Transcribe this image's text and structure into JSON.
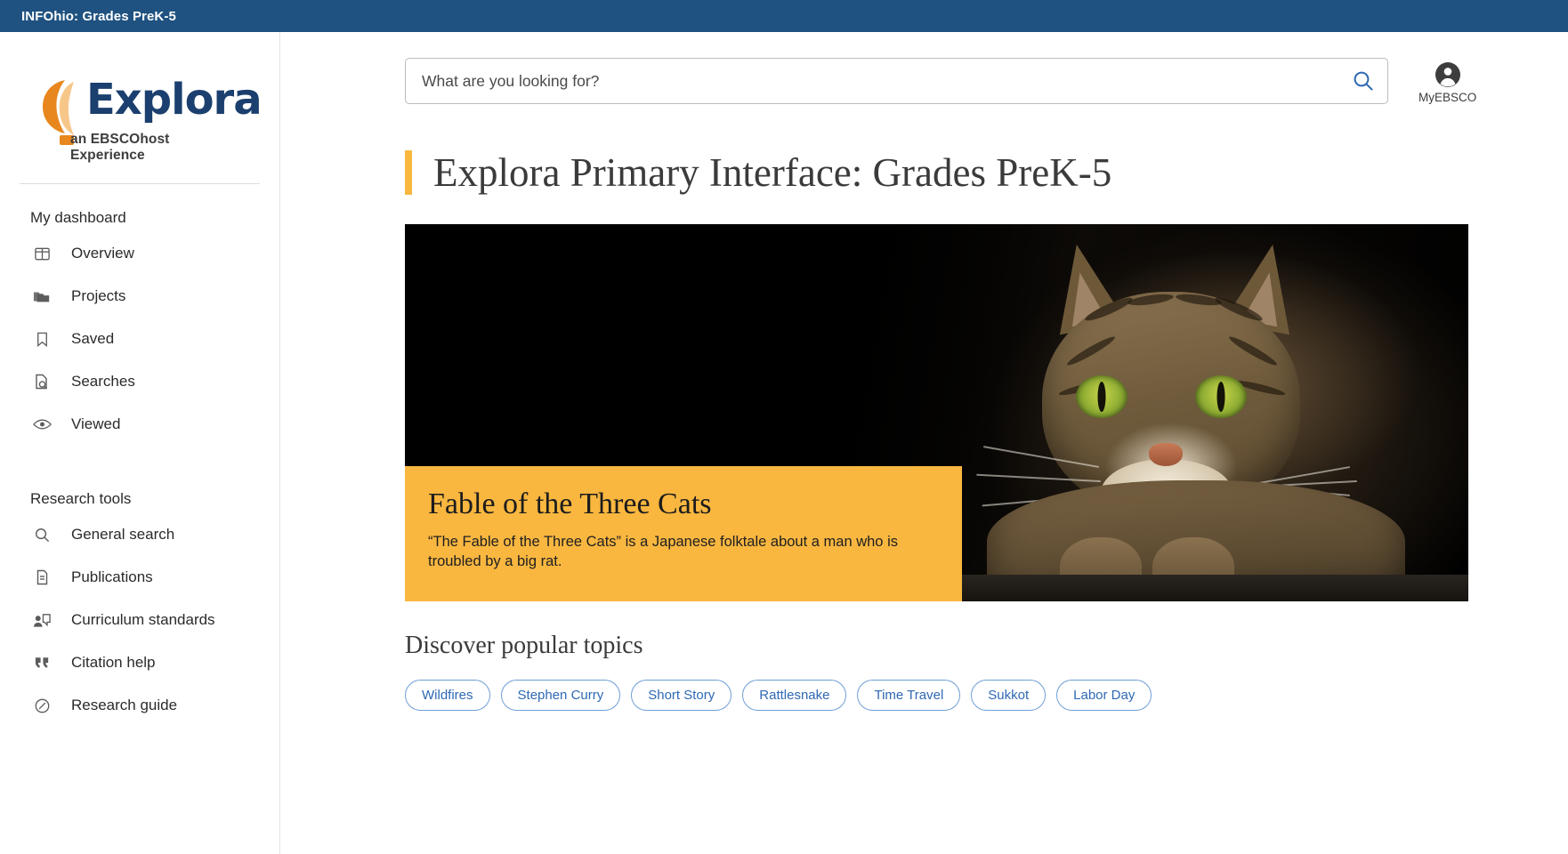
{
  "topbar": {
    "title": "INFOhio: Grades PreK-5"
  },
  "logo": {
    "name": "Explora",
    "tagline": "an EBSCOhost Experience"
  },
  "sidebar": {
    "dashboard_heading": "My dashboard",
    "dashboard_items": [
      {
        "label": "Overview",
        "icon": "layout-panel-icon"
      },
      {
        "label": "Projects",
        "icon": "folder-icon"
      },
      {
        "label": "Saved",
        "icon": "bookmark-icon"
      },
      {
        "label": "Searches",
        "icon": "document-search-icon"
      },
      {
        "label": "Viewed",
        "icon": "eye-icon"
      }
    ],
    "tools_heading": "Research tools",
    "tools_items": [
      {
        "label": "General search",
        "icon": "magnifier-icon"
      },
      {
        "label": "Publications",
        "icon": "document-icon"
      },
      {
        "label": "Curriculum standards",
        "icon": "presentation-person-icon"
      },
      {
        "label": "Citation help",
        "icon": "quotation-marks-icon"
      },
      {
        "label": "Research guide",
        "icon": "compass-icon"
      }
    ]
  },
  "search": {
    "placeholder": "What are you looking for?",
    "value": "",
    "button_icon": "search-icon"
  },
  "account": {
    "label": "MyEBSCO",
    "icon": "user-avatar-icon"
  },
  "page": {
    "title": "Explora Primary Interface: Grades PreK-5"
  },
  "hero": {
    "title": "Fable of the Three Cats",
    "description": "“The Fable of the Three Cats” is a Japanese folktale about a man who is troubled by a big rat.",
    "image_alt": "Tabby cat with green eyes resting on a ledge against a black background"
  },
  "topics": {
    "heading": "Discover popular topics",
    "chips": [
      "Wildfires",
      "Stephen Curry",
      "Short Story",
      "Rattlesnake",
      "Time Travel",
      "Sukkot",
      "Labor Day"
    ]
  },
  "colors": {
    "topbar": "#1f5280",
    "accent_amber": "#f9b740",
    "link_blue": "#2f69b3",
    "logo_navy": "#1b3f6e",
    "logo_orange": "#e8871e"
  }
}
